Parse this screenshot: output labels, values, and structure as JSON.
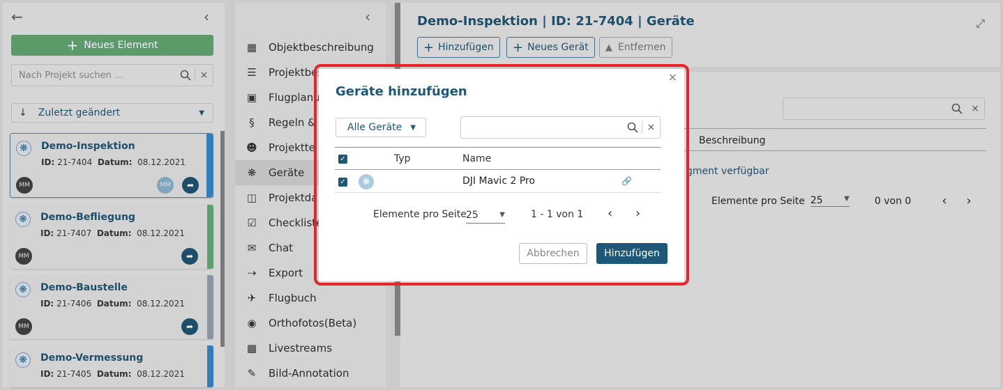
{
  "left_panel": {
    "new_button": "Neues Element",
    "search_placeholder": "Nach Projekt suchen ...",
    "sort_label": "Zuletzt geändert",
    "projects": [
      {
        "title": "Demo-Inspektion",
        "id_label": "ID:",
        "id": "21-7404",
        "date_label": "Datum:",
        "date": "08.12.2021",
        "avatar": "MM",
        "stripe_color": "#2f7fbf"
      },
      {
        "title": "Demo-Befliegung",
        "id_label": "ID:",
        "id": "21-7407",
        "date_label": "Datum:",
        "date": "08.12.2021",
        "avatar": "MM",
        "stripe_color": "#5aa06a"
      },
      {
        "title": "Demo-Baustelle",
        "id_label": "ID:",
        "id": "21-7406",
        "date_label": "Datum:",
        "date": "08.12.2021",
        "avatar": "MM",
        "stripe_color": "#8796a0"
      },
      {
        "title": "Demo-Vermessung",
        "id_label": "ID:",
        "id": "21-7405",
        "date_label": "Datum:",
        "date": "08.12.2021",
        "avatar": "MM",
        "stripe_color": "#2f7fbf"
      }
    ]
  },
  "menu": {
    "items": [
      {
        "label": "Objektbeschreibung",
        "icon": "sitemap-icon"
      },
      {
        "label": "Projektbes",
        "icon": "list-icon"
      },
      {
        "label": "Flugplanu",
        "icon": "map-icon"
      },
      {
        "label": "Regeln & A",
        "icon": "paragraph-icon"
      },
      {
        "label": "Projektte",
        "icon": "users-icon"
      },
      {
        "label": "Geräte",
        "icon": "drone-icon"
      },
      {
        "label": "Projektda",
        "icon": "data-icon"
      },
      {
        "label": "Checkliste",
        "icon": "clipboard-icon"
      },
      {
        "label": "Chat",
        "icon": "chat-icon"
      },
      {
        "label": "Export",
        "icon": "export-icon"
      },
      {
        "label": "Flugbuch",
        "icon": "plane-icon"
      },
      {
        "label": "Orthofotos(Beta)",
        "icon": "camera-icon"
      },
      {
        "label": "Livestreams",
        "icon": "live-icon"
      },
      {
        "label": "Bild-Annotation",
        "icon": "annotate-icon"
      }
    ]
  },
  "main": {
    "title": "Demo-Inspektion | ID: 21-7404 | Geräte",
    "add_button": "Hinzufügen",
    "new_device_button": "Neues Gerät",
    "remove_button": "Entfernen",
    "column_description": "Beschreibung",
    "empty_text": "gment verfügbar",
    "per_page_label": "Elemente pro Seite",
    "per_page_value": "25",
    "range": "0 von 0"
  },
  "modal": {
    "title": "Geräte hinzufügen",
    "filter": "Alle Geräte",
    "col_type": "Typ",
    "col_name": "Name",
    "rows": [
      {
        "name": "DJI Mavic 2 Pro"
      }
    ],
    "per_page_label": "Elemente pro Seite",
    "per_page_value": "25",
    "range": "1 - 1 von 1",
    "cancel": "Abbrechen",
    "confirm": "Hinzufügen"
  }
}
